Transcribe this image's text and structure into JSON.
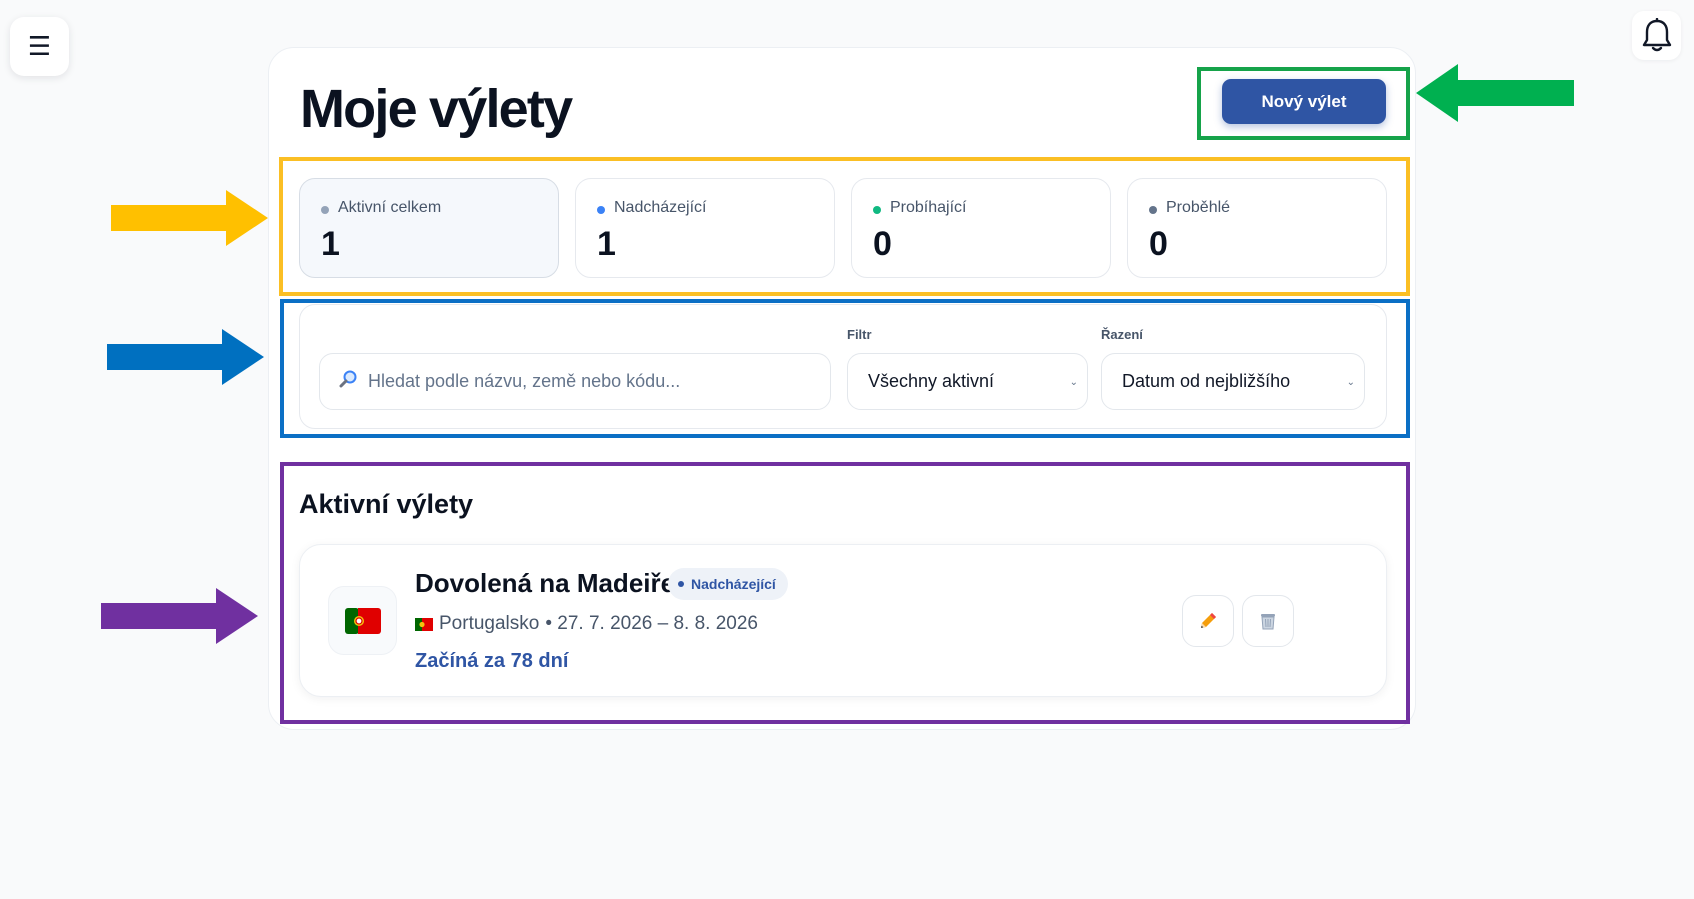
{
  "topbar": {
    "menu_icon": "☰"
  },
  "page": {
    "title": "Moje výlety",
    "new_trip_label": "Nový výlet"
  },
  "stats": [
    {
      "label": "Aktivní celkem",
      "value": "1",
      "color": "#94a3b8"
    },
    {
      "label": "Nadcházející",
      "value": "1",
      "color": "#3b82f6"
    },
    {
      "label": "Probíhající",
      "value": "0",
      "color": "#10b981"
    },
    {
      "label": "Proběhlé",
      "value": "0",
      "color": "#64748b"
    }
  ],
  "filters": {
    "search_placeholder": "Hledat podle názvu, země nebo kódu...",
    "filter_label": "Filtr",
    "filter_value": "Všechny aktivní",
    "sort_label": "Řazení",
    "sort_value": "Datum od nejbližšího"
  },
  "section": {
    "title": "Aktivní výlety"
  },
  "trips": [
    {
      "name": "Dovolená na Madeiře",
      "status": "Nadcházející",
      "country": "Portugalsko",
      "dates": "• 27. 7. 2026 – 8. 8. 2026",
      "countdown": "Začíná za 78 dní"
    }
  ],
  "colors": {
    "accent": "#2f55a4",
    "frame_new_trip": "#16a34a",
    "frame_stats": "#fbbf24",
    "frame_filters": "#0b6fc5",
    "frame_trips": "#7030a0"
  }
}
